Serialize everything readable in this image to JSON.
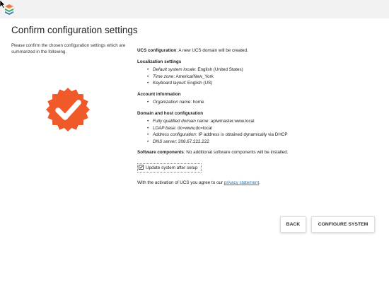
{
  "colors": {
    "accent": "#f07a4a",
    "badge": "#f05a2a",
    "link": "#2a78b5"
  },
  "page": {
    "title": "Confirm configuration settings",
    "intro": "Please confirm the chosen configuration settings which are summarized in the following."
  },
  "ucs": {
    "label": "UCS configuration",
    "text": ": A new UCS domain will be created."
  },
  "localization": {
    "title": "Localization settings",
    "items": [
      {
        "key": "Default system locale",
        "value": ": English (United States)"
      },
      {
        "key": "Time zone",
        "value": ": America/New_York"
      },
      {
        "key": "Keyboard layout",
        "value": ": English (US)"
      }
    ]
  },
  "account": {
    "title": "Account information",
    "items": [
      {
        "key": "Organization name",
        "value": ": home"
      }
    ]
  },
  "domain": {
    "title": "Domain and host configuration",
    "items": [
      {
        "key": "Fully qualified domain name",
        "value": ": aplwmaster.www.local"
      },
      {
        "key": "LDAP base",
        "value": ": dc=www,dc=local"
      },
      {
        "key": "Address configuration",
        "value": ": IP address is obtained dynamically via DHCP"
      },
      {
        "key": "DNS server",
        "value": ": 208.67.222.222"
      }
    ]
  },
  "software": {
    "label": "Software components",
    "text": ": No additional software components will be installed."
  },
  "update": {
    "label": "Update system after setup",
    "checked": true
  },
  "agree": {
    "prefix": "With the activation of UCS you agree to our ",
    "link": "privacy statement",
    "suffix": "."
  },
  "buttons": {
    "back": "BACK",
    "configure": "CONFIGURE SYSTEM"
  }
}
